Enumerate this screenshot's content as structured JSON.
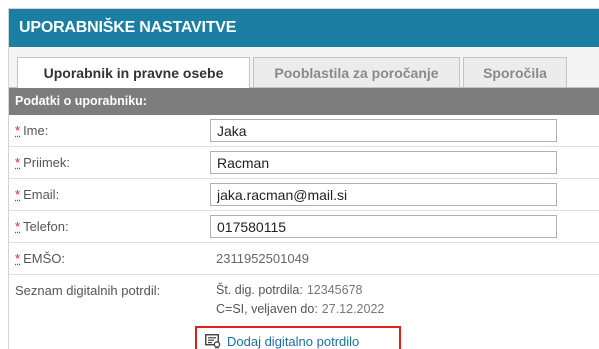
{
  "header": {
    "title": "UPORABNIŠKE NASTAVITVE"
  },
  "tabs": [
    {
      "label": "Uporabnik in pravne osebe",
      "active": true
    },
    {
      "label": "Pooblastila za poročanje",
      "active": false
    },
    {
      "label": "Sporočila",
      "active": false
    }
  ],
  "section": {
    "title": "Podatki o uporabniku:"
  },
  "form": {
    "required_mark": "*",
    "first_name": {
      "label": "Ime:",
      "value": "Jaka"
    },
    "last_name": {
      "label": "Priimek:",
      "value": "Racman"
    },
    "email": {
      "label": "Email:",
      "value": "jaka.racman@mail.si"
    },
    "phone": {
      "label": "Telefon:",
      "value": "017580115"
    },
    "emso": {
      "label": "EMŠO:",
      "value": "2311952501049"
    }
  },
  "certificates": {
    "label": "Seznam digitalnih potrdil:",
    "number_label": "Št. dig. potrdila:",
    "number_value": "12345678",
    "validity_label": "C=SI, veljaven do:",
    "validity_value": "27.12.2022",
    "add_label": "Dodaj digitalno potrdilo"
  },
  "colors": {
    "title_bar": "#1b7fa3",
    "section_header": "#7d7d7d",
    "link": "#1b6fa3",
    "highlight_box": "#e02020",
    "required": "#d22222"
  },
  "icons": {
    "add_certificate": "certificate-add-icon"
  }
}
